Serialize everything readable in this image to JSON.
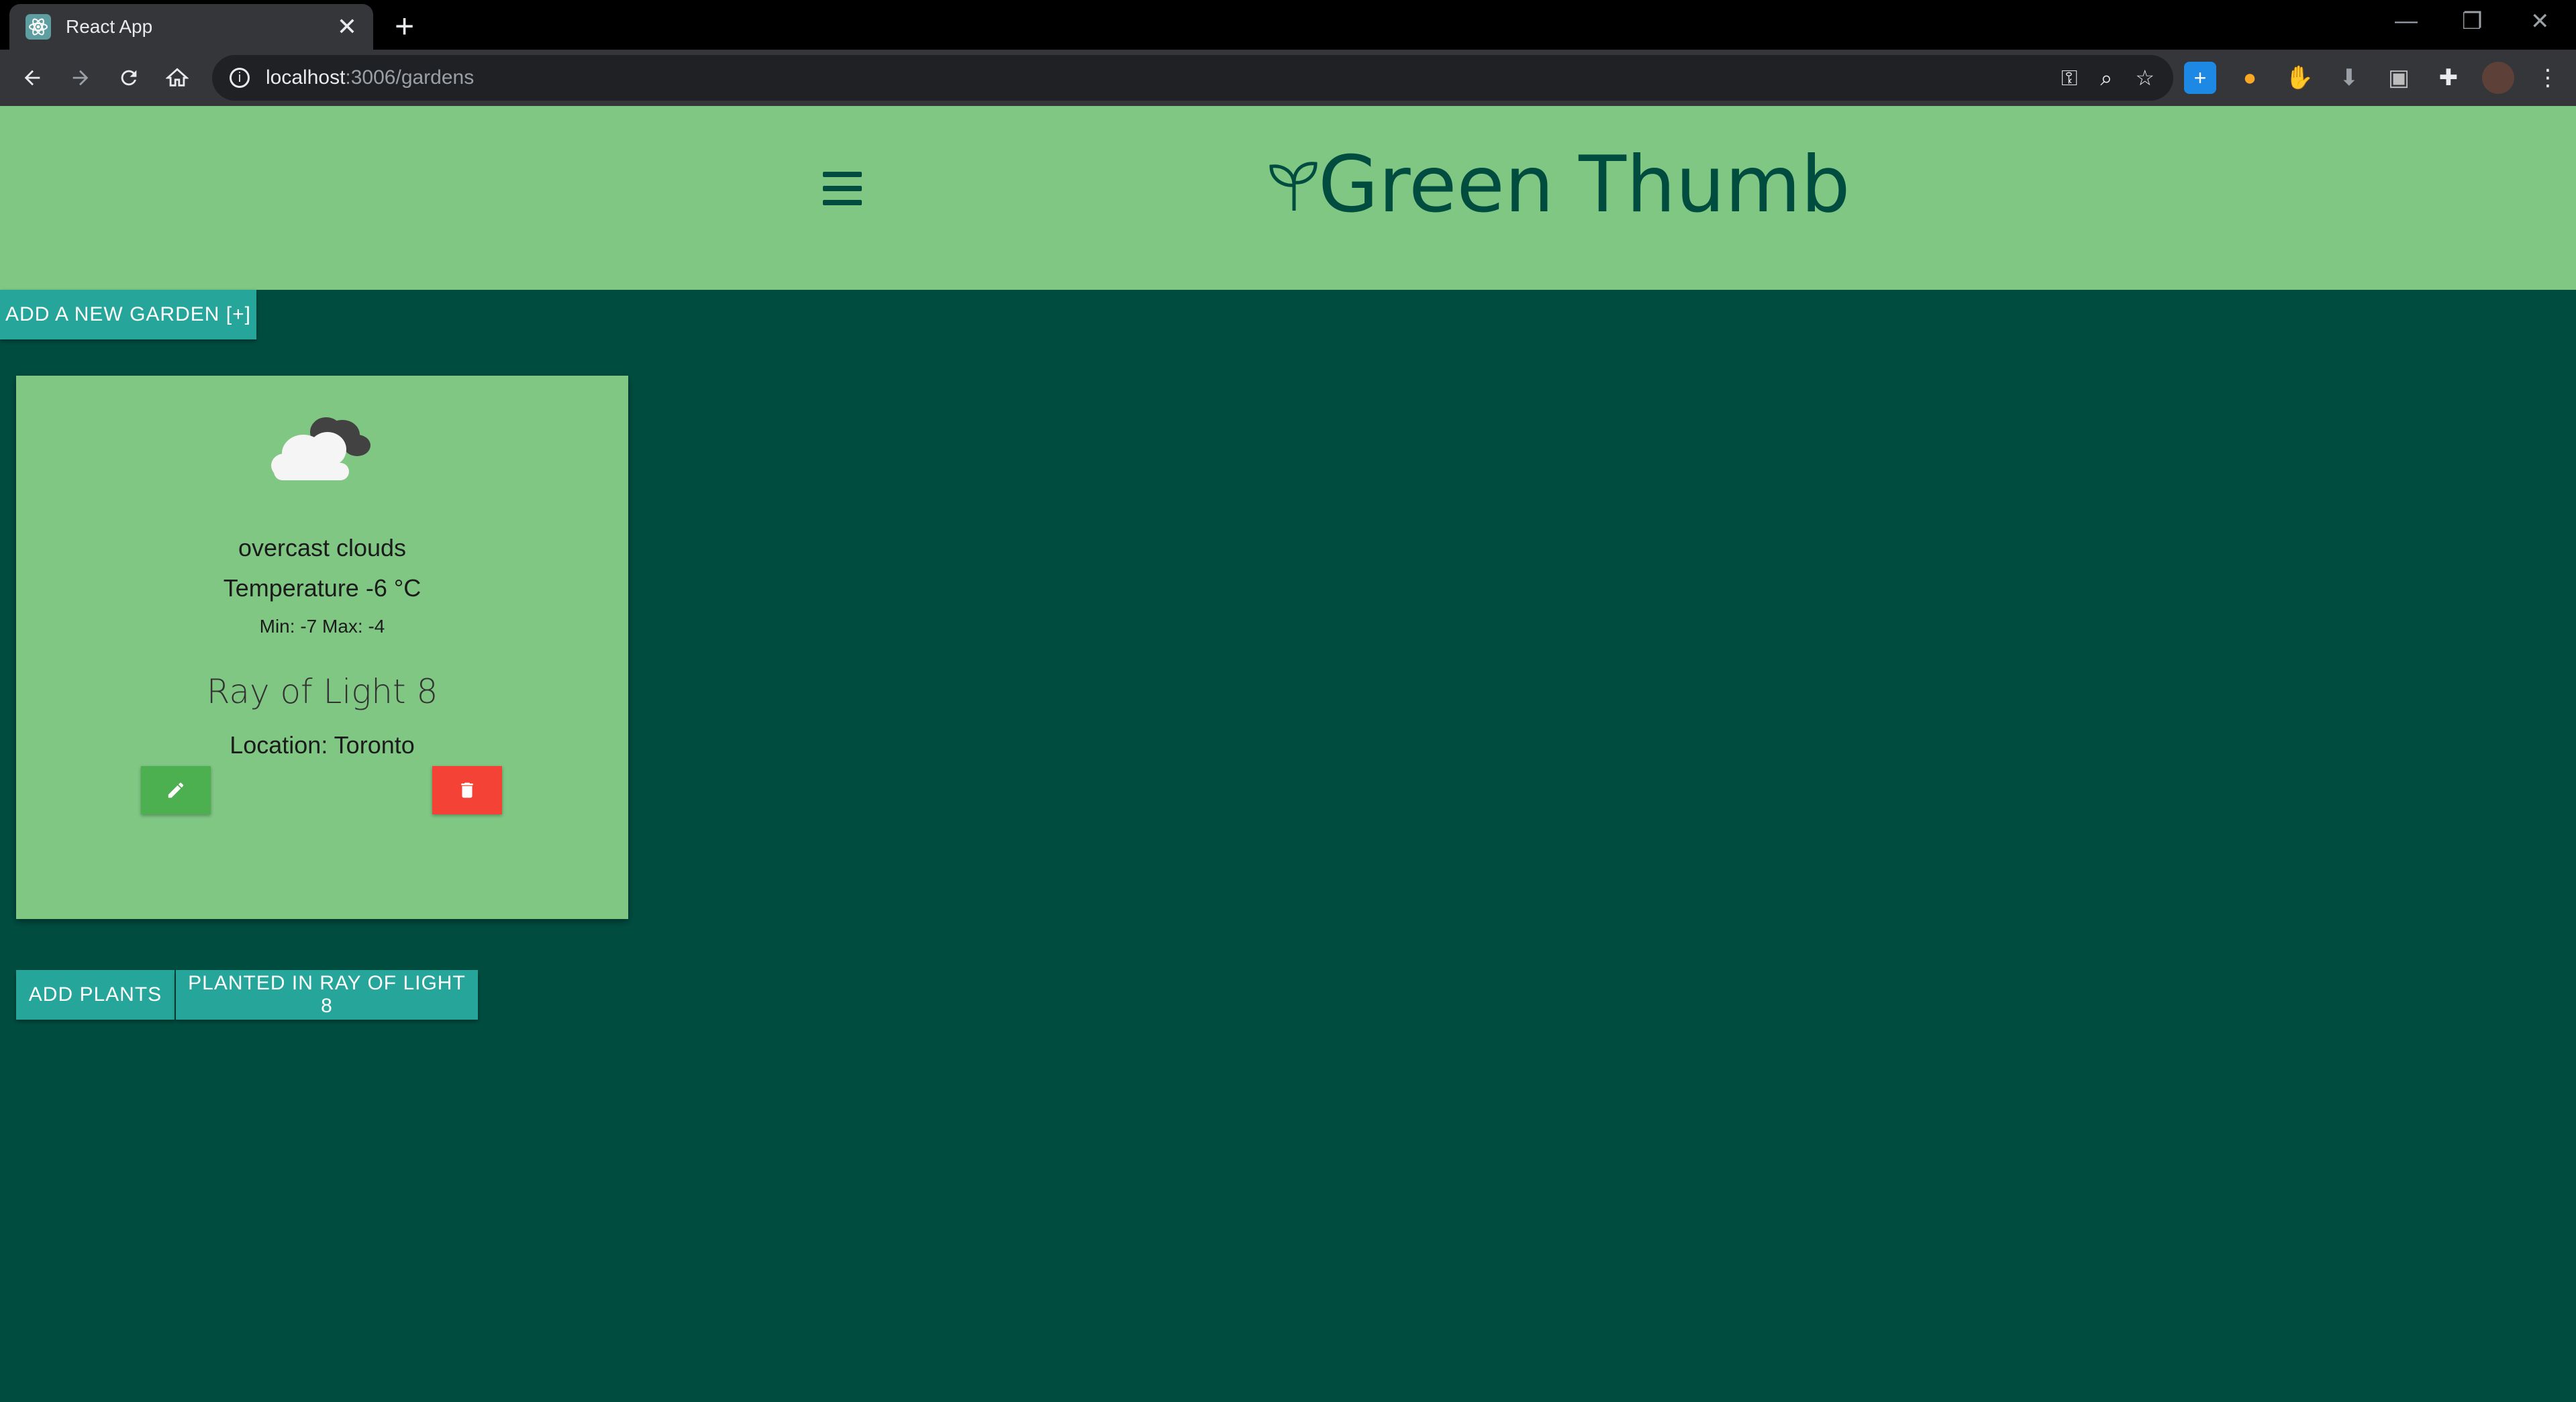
{
  "browser": {
    "tab_title": "React App",
    "tab_close": "✕",
    "new_tab": "+",
    "url_host": "localhost",
    "url_path": ":3006/gardens",
    "window_controls": [
      "—",
      "❐",
      "✕"
    ]
  },
  "header": {
    "title": "Green Thumb",
    "menu_icon": "hamburger-menu-icon",
    "logo_icon": "sprout-icon",
    "background": "#81c784",
    "text_color": "#004d40"
  },
  "toolbar": {
    "add_garden_label": "ADD A NEW GARDEN [+]"
  },
  "garden_card": {
    "weather_icon": "overcast-clouds-icon",
    "weather_description": "overcast clouds",
    "temperature": "Temperature -6 °C",
    "min_max": "Min: -7 Max: -4",
    "name": "Ray of Light 8",
    "location": "Location: Toronto",
    "edit_icon": "pencil-icon",
    "delete_icon": "trash-icon"
  },
  "actions": {
    "add_plants_label": "ADD PLANTS",
    "planted_label": "PLANTED IN RAY OF LIGHT 8"
  },
  "colors": {
    "page_background": "#004d40",
    "accent": "#26a69a",
    "edit": "#4caf50",
    "delete": "#f44336"
  }
}
